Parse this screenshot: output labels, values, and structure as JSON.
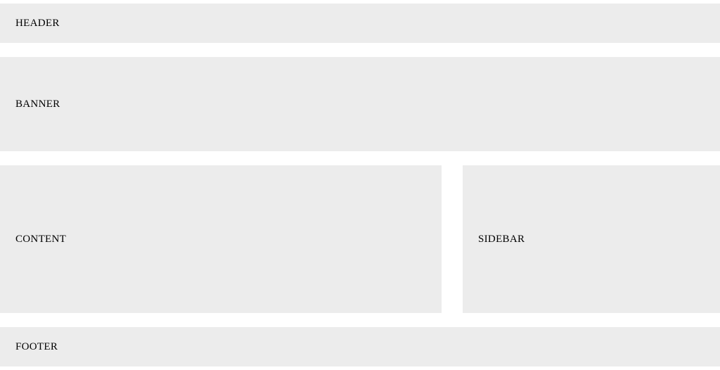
{
  "layout": {
    "header": "HEADER",
    "banner": "BANNER",
    "content": "CONTENT",
    "sidebar": "SIDEBAR",
    "footer": "FOOTER"
  }
}
